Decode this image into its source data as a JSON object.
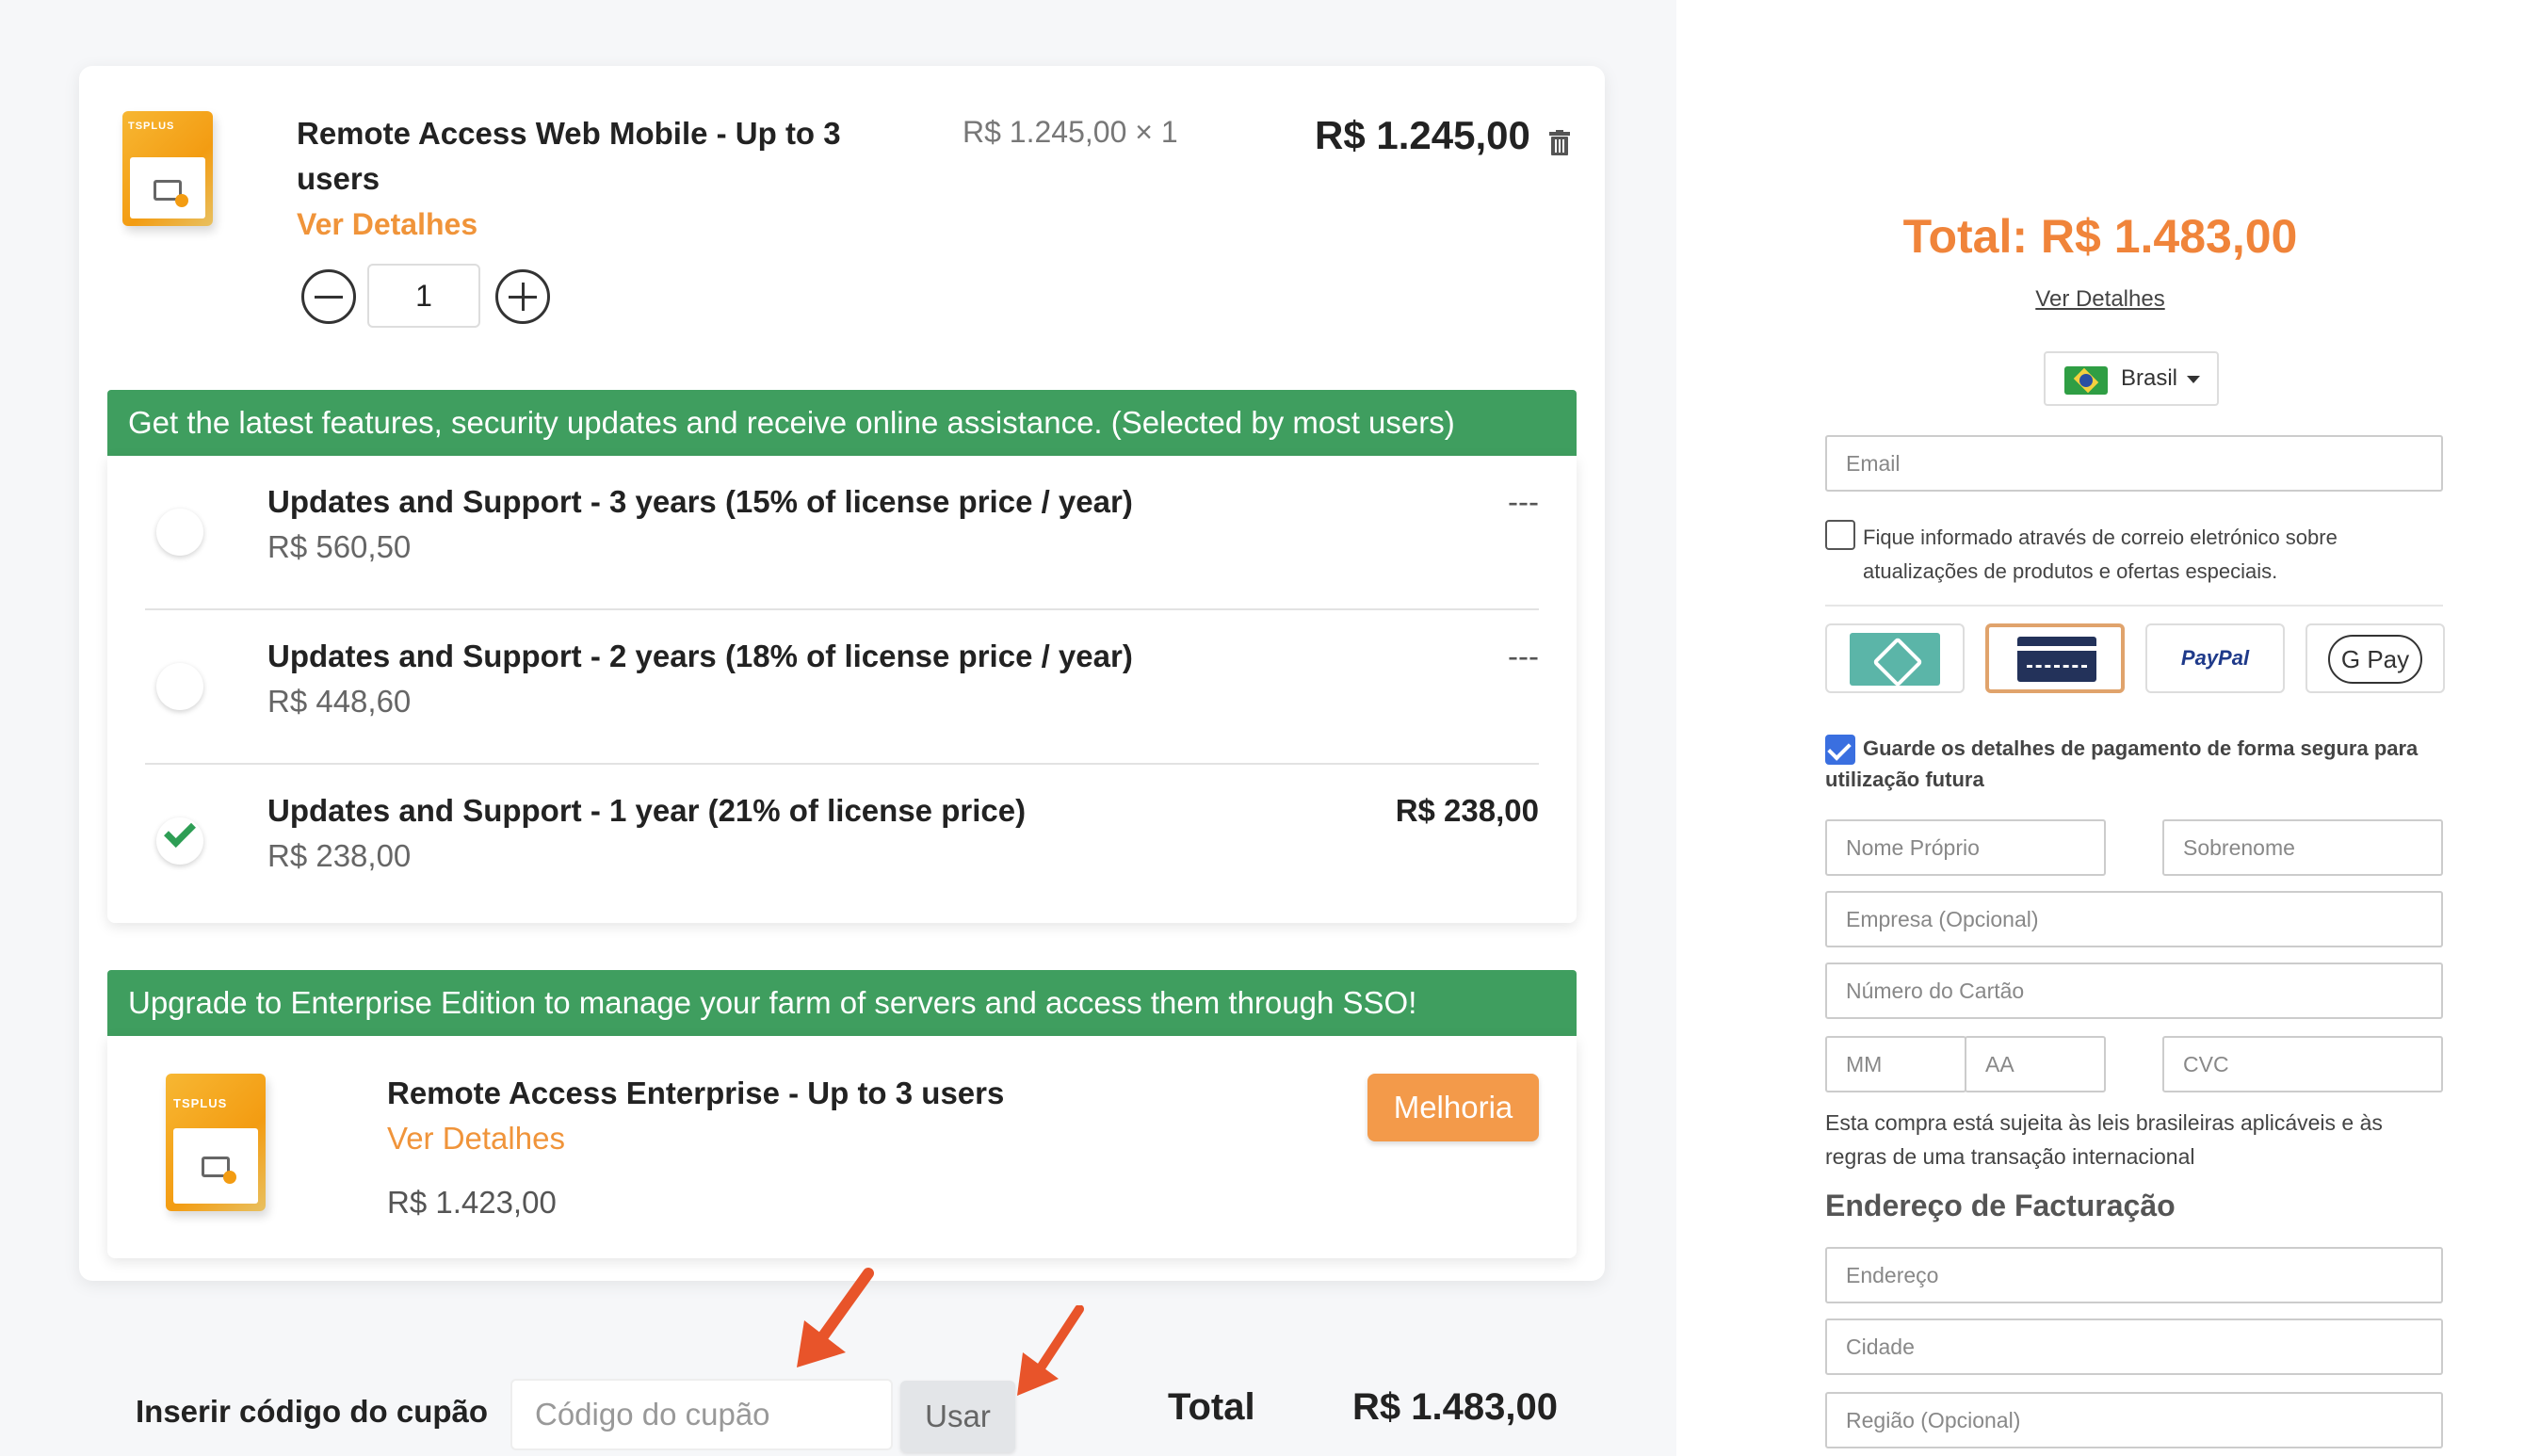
{
  "cart": {
    "product": {
      "title": "Remote Access Web Mobile - Up to 3 users",
      "details_link": "Ver Detalhes",
      "unit_price": "R$ 1.245,00 × 1",
      "line_total": "R$ 1.245,00",
      "quantity": "1",
      "box_logo": "TSPLUS"
    },
    "support": {
      "banner": "Get the latest features, security updates and receive online assistance. (Selected by most users)",
      "options": [
        {
          "title": "Updates and Support - 3 years (15% of license price / year)",
          "price": "R$ 560,50",
          "right": "---",
          "selected": false
        },
        {
          "title": "Updates and Support - 2 years (18% of license price / year)",
          "price": "R$ 448,60",
          "right": "---",
          "selected": false
        },
        {
          "title": "Updates and Support - 1 year (21% of license price)",
          "price": "R$ 238,00",
          "right": "R$ 238,00",
          "selected": true
        }
      ]
    },
    "upgrade": {
      "banner": "Upgrade to Enterprise Edition to manage your farm of servers and access them through SSO!",
      "title": "Remote Access Enterprise - Up to 3 users",
      "details_link": "Ver Detalhes",
      "price": "R$ 1.423,00",
      "button": "Melhoria",
      "box_logo": "TSPLUS"
    },
    "coupon": {
      "label": "Inserir código do cupão",
      "placeholder": "Código do cupão",
      "button": "Usar"
    },
    "total": {
      "label": "Total",
      "value": "R$ 1.483,00"
    }
  },
  "checkout": {
    "total": "Total: R$ 1.483,00",
    "details_link": "Ver Detalhes",
    "country": "Brasil",
    "email_placeholder": "Email",
    "newsletter": "Fique informado através de correio eletrónico sobre atualizações de produtos e ofertas especiais.",
    "payment_methods": [
      "pix-icon",
      "credit-card-icon",
      "paypal-icon",
      "google-pay-icon"
    ],
    "paypal_label": "PayPal",
    "gpay_label": "G Pay",
    "save_details": "Guarde os detalhes de pagamento de forma segura para utilização futura",
    "fields": {
      "first_name": "Nome Próprio",
      "last_name": "Sobrenome",
      "company": "Empresa (Opcional)",
      "card_number": "Número do Cartão",
      "mm": "MM",
      "aa": "AA",
      "cvc": "CVC"
    },
    "legal": "Esta compra está sujeita às leis brasileiras aplicáveis e às regras de uma transação internacional",
    "billing_heading": "Endereço de Facturação",
    "billing_fields": {
      "address": "Endereço",
      "city": "Cidade",
      "region": "Região (Opcional)"
    }
  },
  "colors": {
    "accent_orange": "#f0843a",
    "green_band": "#3f9e5f",
    "check_green": "#2e9e55",
    "upgrade_button": "#f39a4a",
    "annotation_arrow": "#e8542a"
  }
}
